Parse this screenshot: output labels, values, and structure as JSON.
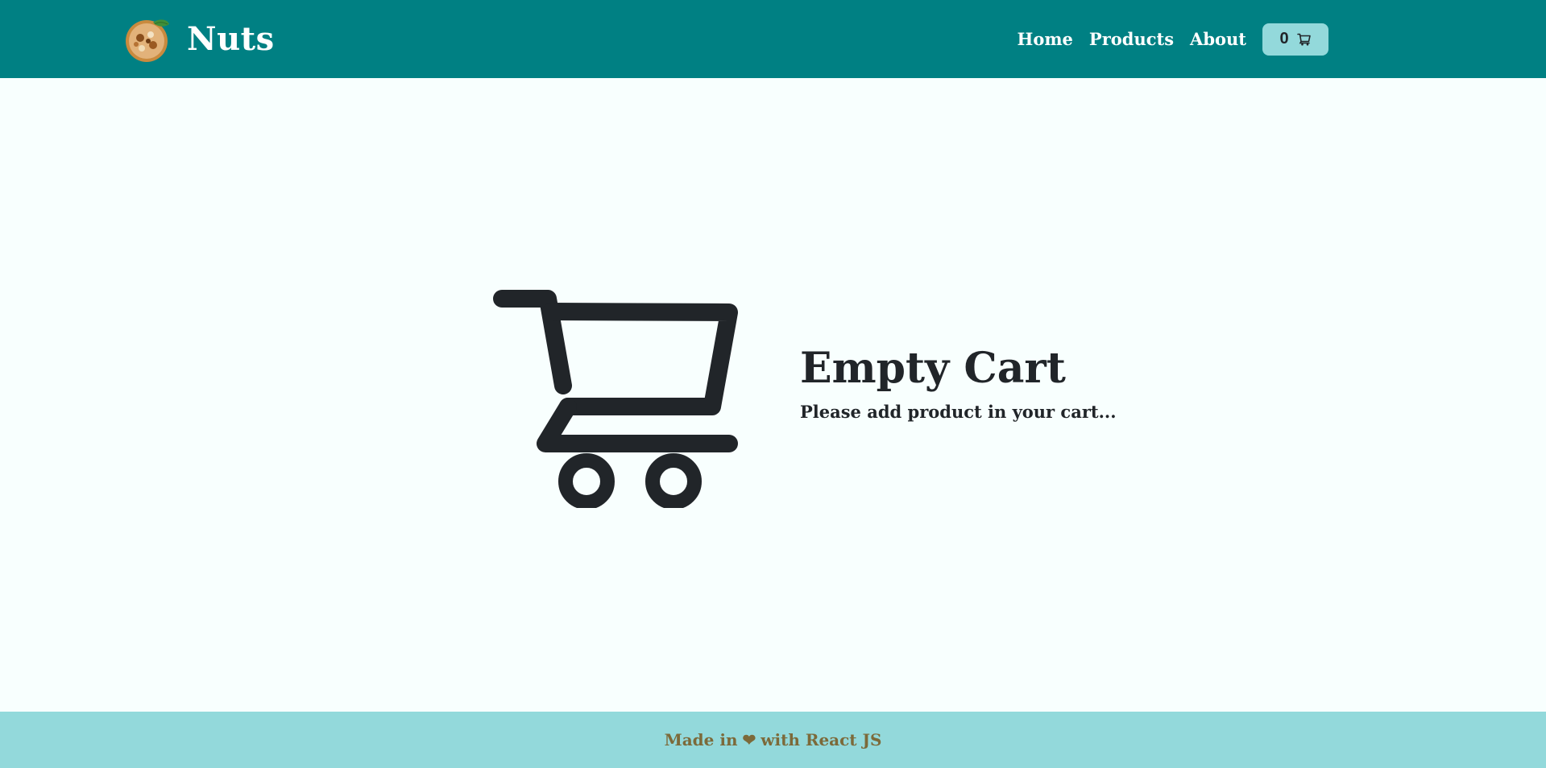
{
  "navbar": {
    "brand": "Nuts",
    "links": [
      "Home",
      "Products",
      "About"
    ],
    "cart_count": "0",
    "colors": {
      "background": "#008083",
      "cart_button": "#93d9db"
    }
  },
  "main": {
    "title": "Empty Cart",
    "subtitle": "Please add product in your cart...",
    "icon": "shopping-cart-icon"
  },
  "footer": {
    "text_before": "Made in",
    "heart": "❤",
    "text_after": "with React JS",
    "colors": {
      "background": "#93d9db",
      "text": "#7c6a3a"
    }
  }
}
